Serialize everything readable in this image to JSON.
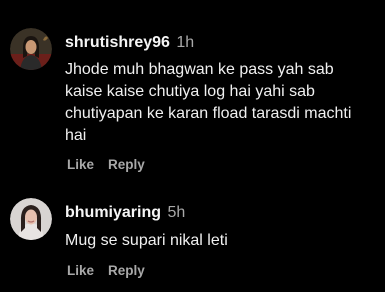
{
  "comments": [
    {
      "username": "shrutishrey96",
      "time": "1h",
      "text": "Jhode muh bhagwan ke pass yah sab kaise kaise chutiya log hai yahi sab chutiyapan ke karan fload tarasdi machti hai",
      "like_label": "Like",
      "reply_label": "Reply"
    },
    {
      "username": "bhumiyaring",
      "time": "5h",
      "text": "Mug se supari nikal leti",
      "like_label": "Like",
      "reply_label": "Reply"
    }
  ],
  "colors": {
    "background": "#000000",
    "primary_text": "#f5f5f5",
    "secondary_text": "#a8a8a8"
  }
}
